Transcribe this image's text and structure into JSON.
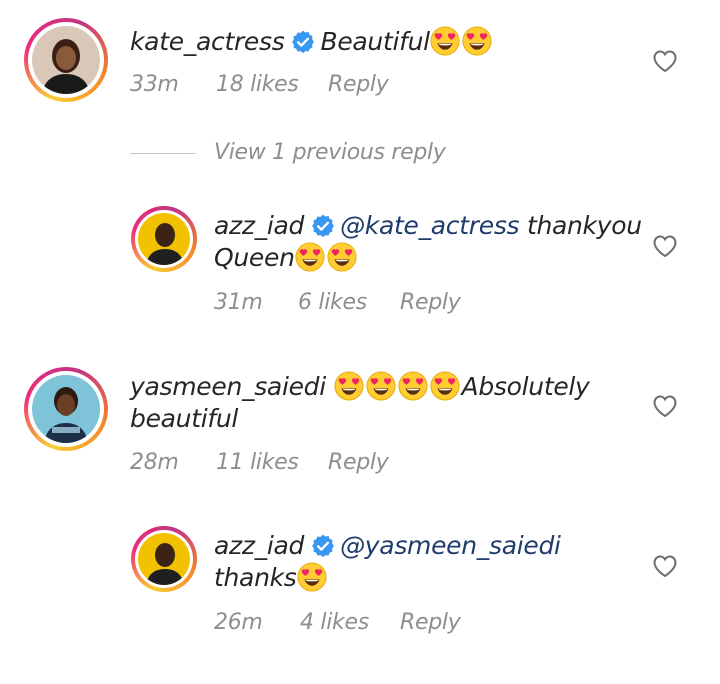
{
  "comments": [
    {
      "username": "kate_actress",
      "text": "Beautiful",
      "emoji_count": 2,
      "time": "33m",
      "likes": "18 likes",
      "reply_label": "Reply"
    },
    {
      "username": "azz_iad",
      "mention": "@kate_actress",
      "text": "thankyou",
      "text_line2": "Queen",
      "emoji_count": 2,
      "time": "31m",
      "likes": "6 likes",
      "reply_label": "Reply"
    },
    {
      "username": "yasmeen_saiedi",
      "emoji_count": 4,
      "text": "Absolutely",
      "text_line2": "beautiful",
      "time": "28m",
      "likes": "11 likes",
      "reply_label": "Reply"
    },
    {
      "username": "azz_iad",
      "mention": "@yasmeen_saiedi",
      "text_line2": "thanks",
      "emoji_count": 1,
      "time": "26m",
      "likes": "4 likes",
      "reply_label": "Reply"
    }
  ],
  "view_replies": "View 1 previous reply",
  "icons": {
    "verified": "verified-badge-icon",
    "like": "heart-outline-icon",
    "emoji": "heart-eyes-emoji"
  },
  "colors": {
    "verified": "#3897f0",
    "mention": "#1f3d6b",
    "meta": "#8e8e8e"
  }
}
